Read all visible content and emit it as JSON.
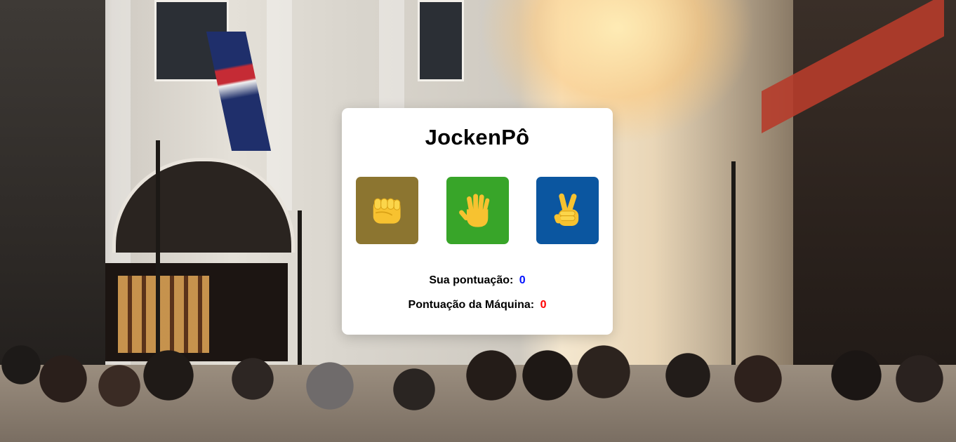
{
  "game": {
    "title": "JockenPô",
    "choices": [
      {
        "name": "rock",
        "icon": "fist-icon",
        "color": "#8c7530"
      },
      {
        "name": "paper",
        "icon": "raised-hand-icon",
        "color": "#38a529"
      },
      {
        "name": "scissors",
        "icon": "victory-hand-icon",
        "color": "#0b56a0"
      }
    ],
    "user_score_label": "Sua pontuação:",
    "user_score": "0",
    "user_score_color": "#0010ff",
    "machine_score_label": "Pontuação da Máquina:",
    "machine_score": "0",
    "machine_score_color": "#ff0000"
  }
}
